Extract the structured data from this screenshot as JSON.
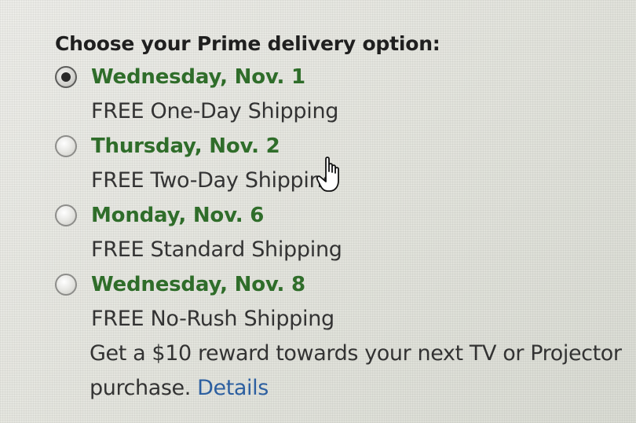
{
  "heading": "Choose your Prime delivery option:",
  "options": [
    {
      "date": "Wednesday, Nov. 1",
      "shipping": "FREE One-Day Shipping",
      "selected": true
    },
    {
      "date": "Thursday, Nov. 2",
      "shipping": "FREE Two-Day Shipping",
      "selected": false
    },
    {
      "date": "Monday, Nov. 6",
      "shipping": "FREE Standard Shipping",
      "selected": false
    },
    {
      "date": "Wednesday, Nov. 8",
      "shipping": "FREE No-Rush Shipping",
      "selected": false
    }
  ],
  "promo": {
    "text": "Get a $10 reward towards your next TV or Projector purchase.",
    "link": "Details"
  },
  "colors": {
    "date_green": "#2f6d2a",
    "link_blue": "#2c5fa0",
    "text": "#333333"
  }
}
